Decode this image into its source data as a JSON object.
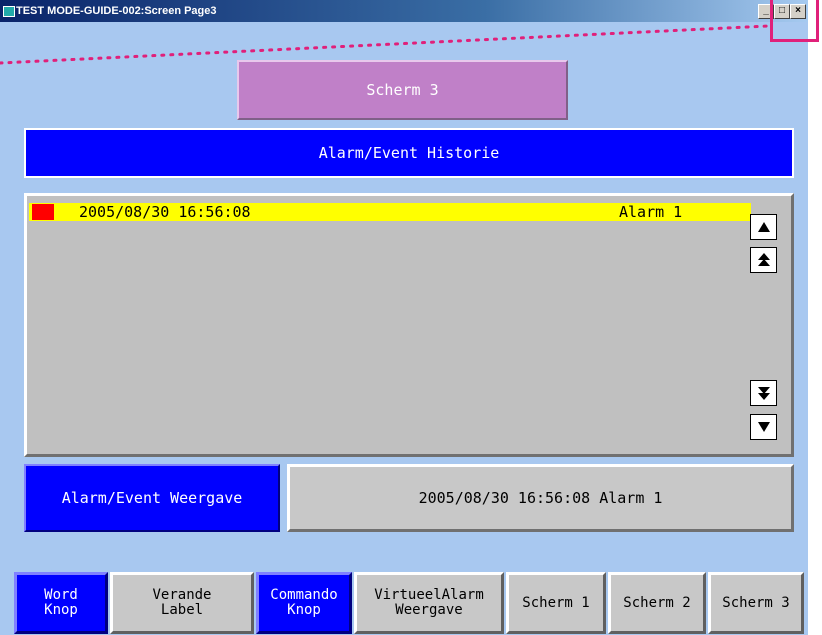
{
  "window": {
    "title": "TEST MODE-GUIDE-002:Screen Page3",
    "min_label": "_",
    "max_label": "□",
    "close_label": "×"
  },
  "screen": {
    "title": "Scherm 3",
    "header": "Alarm/Event Historie"
  },
  "alarm_list": {
    "rows": [
      {
        "timestamp": "2005/08/30 16:56:08",
        "name": "Alarm 1",
        "marker_color": "#ff0000",
        "row_color": "#ffff00"
      }
    ],
    "scroll_up": "▲",
    "scroll_top": "⏫",
    "scroll_bottom": "⏬",
    "scroll_down": "▼"
  },
  "weergave_button": "Alarm/Event Weergave",
  "alarm_display": "2005/08/30 16:56:08 Alarm 1",
  "bottom_buttons": [
    {
      "label": "Word\nKnop",
      "active": true
    },
    {
      "label": "Verande\nLabel",
      "active": false
    },
    {
      "label": "Commando\nKnop",
      "active": true
    },
    {
      "label": "VirtueelAlarm\nWeergave",
      "active": false
    },
    {
      "label": "Scherm 1",
      "active": false
    },
    {
      "label": "Scherm 2",
      "active": false
    },
    {
      "label": "Scherm 3",
      "active": false
    }
  ],
  "colors": {
    "background": "#a8c8f0",
    "blue": "#0000ff",
    "purple": "#c080c8",
    "annotation": "#e0207a"
  }
}
